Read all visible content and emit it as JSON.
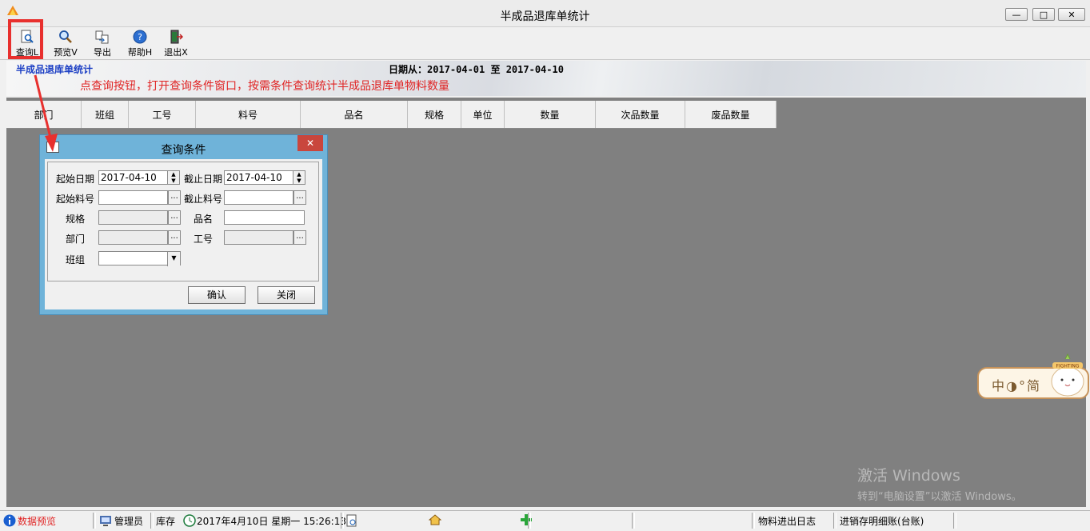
{
  "window": {
    "title": "半成品退库单统计",
    "min_glyph": "—",
    "max_glyph": "□",
    "close_glyph": "✕"
  },
  "toolbar": {
    "query_label": "查询L",
    "preview_label": "预览V",
    "export_label": "导出",
    "help_label": "帮助H",
    "exit_label": "退出X"
  },
  "banner": {
    "title": "半成品退库单统计",
    "date_range": "日期从：2017-04-01 至 2017-04-10",
    "annotation": "点查询按钮，打开查询条件窗口，按需条件查询统计半成品退库单物料数量"
  },
  "grid": {
    "columns": [
      "部门",
      "班组",
      "工号",
      "料号",
      "品名",
      "规格",
      "单位",
      "数量",
      "次品数量",
      "废品数量"
    ]
  },
  "dialog": {
    "title": "查询条件",
    "close_glyph": "✕",
    "start_date_label": "起始日期",
    "start_date_value": "2017-04-10",
    "end_date_label": "截止日期",
    "end_date_value": "2017-04-10",
    "start_item_label": "起始料号",
    "end_item_label": "截止料号",
    "spec_label": "规格",
    "name_label": "品名",
    "dept_label": "部门",
    "empno_label": "工号",
    "team_label": "班组",
    "ellipsis": "...",
    "spin_up": "▲",
    "spin_down": "▼",
    "dropdown_glyph": "▼",
    "confirm_label": "确认",
    "close_label": "关闭"
  },
  "ime": {
    "text": "中◑°简",
    "mascot_text": "FIGHTING"
  },
  "watermark": {
    "line1": "激活 Windows",
    "line2": "转到“电脑设置”以激活 Windows。"
  },
  "statusbar": {
    "data_preview": "数据预览",
    "user": "管理员",
    "module": "库存",
    "datetime": "2017年4月10日 星期一 15:26:13",
    "log": "物料进出日志",
    "ledger": "进销存明细账(台账)"
  },
  "colors": {
    "highlight": "#e8302e",
    "banner_title": "#1c3fc4",
    "annotation": "#e02424",
    "dialog_frame": "#6fb3d9"
  }
}
